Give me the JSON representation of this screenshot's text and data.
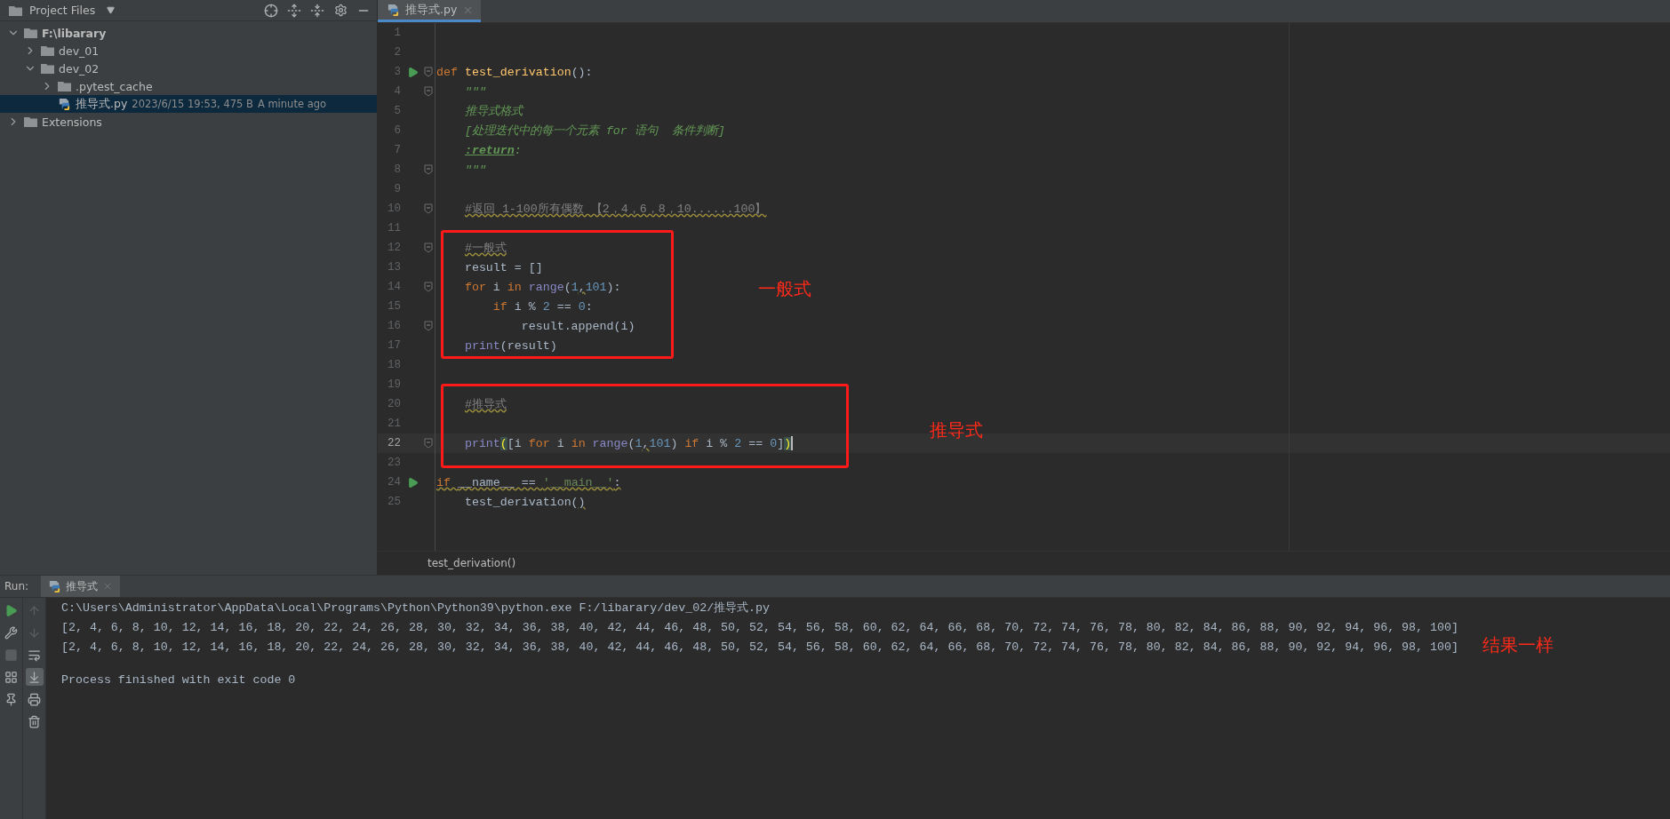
{
  "project_panel": {
    "title": "Project Files",
    "tree": [
      {
        "label": "F:\\libarary",
        "kind": "root",
        "expanded": true,
        "selected": false,
        "children": [
          {
            "label": "dev_01",
            "kind": "folder",
            "expanded": false,
            "selected": false
          },
          {
            "label": "dev_02",
            "kind": "folder",
            "expanded": true,
            "selected": false,
            "children": [
              {
                "label": ".pytest_cache",
                "kind": "folder",
                "expanded": false,
                "selected": false
              },
              {
                "label": "推导式.py",
                "kind": "file",
                "selected": true,
                "meta": "2023/6/15 19:53, 475 B",
                "modified": "A minute ago"
              }
            ]
          }
        ]
      },
      {
        "label": "Extensions",
        "kind": "folder",
        "expanded": false,
        "selected": false
      }
    ]
  },
  "editor": {
    "tab": {
      "label": "推导式.py",
      "selected": true
    },
    "lines": [
      {
        "number": "1",
        "run": false,
        "fold": false,
        "current": false
      },
      {
        "number": "2",
        "run": false,
        "fold": false,
        "current": false
      },
      {
        "number": "3",
        "run": true,
        "fold": true,
        "current": false,
        "tokens": [
          {
            "text": "def ",
            "kind": "kw"
          },
          {
            "text": "test_derivation",
            "kind": "fn"
          },
          {
            "text": "():",
            "kind": "txt"
          }
        ]
      },
      {
        "number": "4",
        "run": false,
        "fold": true,
        "current": false,
        "tokens": [
          {
            "text": "    \"\"\"",
            "kind": "doc"
          }
        ]
      },
      {
        "number": "5",
        "run": false,
        "fold": false,
        "current": false,
        "tokens": [
          {
            "text": "    推导式格式",
            "kind": "doc"
          }
        ]
      },
      {
        "number": "6",
        "run": false,
        "fold": false,
        "current": false,
        "tokens": [
          {
            "text": "    [处理迭代中的每一个元素 for 语句  条件判断]",
            "kind": "doc"
          }
        ]
      },
      {
        "number": "7",
        "run": false,
        "fold": false,
        "current": false,
        "tokens": [
          {
            "text": "    :return",
            "kind": "doctag"
          },
          {
            "text": ":",
            "kind": "doc"
          }
        ]
      },
      {
        "number": "8",
        "run": false,
        "fold": true,
        "current": false,
        "tokens": [
          {
            "text": "    \"\"\"",
            "kind": "doc"
          }
        ]
      },
      {
        "number": "9",
        "run": false,
        "fold": false,
        "current": false
      },
      {
        "number": "10",
        "run": false,
        "fold": true,
        "current": false,
        "tokens": [
          {
            "text": "    #返回 1-100所有偶数 【2，4，6，8，10......100】",
            "kind": "cmt",
            "warn": true
          }
        ]
      },
      {
        "number": "11",
        "run": false,
        "fold": false,
        "current": false
      },
      {
        "number": "12",
        "run": false,
        "fold": true,
        "current": false,
        "tokens": [
          {
            "text": "    #一般式",
            "kind": "cmt",
            "warn": true
          }
        ]
      },
      {
        "number": "13",
        "run": false,
        "fold": false,
        "current": false,
        "tokens": [
          {
            "text": "    result = []",
            "kind": "txt"
          }
        ]
      },
      {
        "number": "14",
        "run": false,
        "fold": true,
        "current": false,
        "tokens": [
          {
            "text": "    for ",
            "kind": "kw"
          },
          {
            "text": "i ",
            "kind": "txt"
          },
          {
            "text": "in ",
            "kind": "kw"
          },
          {
            "text": "range",
            "kind": "bi"
          },
          {
            "text": "(",
            "kind": "txt"
          },
          {
            "text": "1",
            "kind": "num"
          },
          {
            "text": ",",
            "kind": "txt",
            "warn": true
          },
          {
            "text": "101",
            "kind": "num"
          },
          {
            "text": "):",
            "kind": "txt"
          }
        ]
      },
      {
        "number": "15",
        "run": false,
        "fold": false,
        "current": false,
        "tokens": [
          {
            "text": "        if ",
            "kind": "kw"
          },
          {
            "text": "i % ",
            "kind": "txt"
          },
          {
            "text": "2",
            "kind": "num"
          },
          {
            "text": " == ",
            "kind": "txt"
          },
          {
            "text": "0",
            "kind": "num"
          },
          {
            "text": ":",
            "kind": "txt"
          }
        ]
      },
      {
        "number": "16",
        "run": false,
        "fold": true,
        "current": false,
        "tokens": [
          {
            "text": "            result.append(i)",
            "kind": "txt"
          }
        ]
      },
      {
        "number": "17",
        "run": false,
        "fold": false,
        "current": false,
        "tokens": [
          {
            "text": "    print",
            "kind": "bi"
          },
          {
            "text": "(result)",
            "kind": "txt"
          }
        ]
      },
      {
        "number": "18",
        "run": false,
        "fold": false,
        "current": false
      },
      {
        "number": "19",
        "run": false,
        "fold": false,
        "current": false
      },
      {
        "number": "20",
        "run": false,
        "fold": false,
        "current": false,
        "tokens": [
          {
            "text": "    #推导式",
            "kind": "cmt",
            "warn": true
          }
        ]
      },
      {
        "number": "21",
        "run": false,
        "fold": false,
        "current": false
      },
      {
        "number": "22",
        "run": false,
        "fold": true,
        "current": true,
        "tokens": [
          {
            "text": "    print",
            "kind": "bi"
          },
          {
            "text": "(",
            "kind": "match"
          },
          {
            "text": "[i ",
            "kind": "txt"
          },
          {
            "text": "for ",
            "kind": "kw"
          },
          {
            "text": "i ",
            "kind": "txt"
          },
          {
            "text": "in ",
            "kind": "kw"
          },
          {
            "text": "range",
            "kind": "bi"
          },
          {
            "text": "(",
            "kind": "txt"
          },
          {
            "text": "1",
            "kind": "num"
          },
          {
            "text": ",",
            "kind": "txt",
            "warn": true
          },
          {
            "text": "101",
            "kind": "num"
          },
          {
            "text": ") ",
            "kind": "txt"
          },
          {
            "text": "if ",
            "kind": "kw"
          },
          {
            "text": "i % ",
            "kind": "txt"
          },
          {
            "text": "2",
            "kind": "num"
          },
          {
            "text": " == ",
            "kind": "txt"
          },
          {
            "text": "0",
            "kind": "num"
          },
          {
            "text": "]",
            "kind": "txt"
          },
          {
            "text": ")",
            "kind": "match"
          }
        ]
      },
      {
        "number": "23",
        "run": false,
        "fold": false,
        "current": false
      },
      {
        "number": "24",
        "run": true,
        "fold": false,
        "current": false,
        "tokens": [
          {
            "text": "if ",
            "kind": "kw",
            "warn": true
          },
          {
            "text": "__name__ == ",
            "kind": "txt",
            "warn": true
          },
          {
            "text": "'__main__'",
            "kind": "str",
            "warn": true
          },
          {
            "text": ":",
            "kind": "txt",
            "warn": true
          }
        ]
      },
      {
        "number": "25",
        "run": false,
        "fold": false,
        "current": false,
        "tokens": [
          {
            "text": "    test_derivation(",
            "kind": "txt"
          },
          {
            "text": ")",
            "kind": "txt",
            "warn": true
          }
        ]
      }
    ],
    "breadcrumb": "test_derivation()",
    "annotations": [
      {
        "label": "一般式"
      },
      {
        "label": "推导式"
      }
    ]
  },
  "run_panel": {
    "label": "Run:",
    "tab": {
      "label": "推导式",
      "selected": true
    },
    "tools_left": [
      {
        "kind": "run",
        "disabled": false
      },
      {
        "kind": "wrench",
        "disabled": false
      },
      {
        "kind": "stop",
        "disabled": true
      },
      {
        "kind": "layout",
        "disabled": false
      },
      {
        "kind": "pin",
        "disabled": false
      }
    ],
    "tools_right": [
      {
        "kind": "up",
        "disabled": true,
        "on": false
      },
      {
        "kind": "down",
        "disabled": true,
        "on": false
      },
      {
        "kind": "wrap",
        "disabled": false,
        "on": false
      },
      {
        "kind": "scroll_end",
        "disabled": false,
        "on": true
      },
      {
        "kind": "print",
        "disabled": false,
        "on": false
      },
      {
        "kind": "trash",
        "disabled": false,
        "on": false
      }
    ],
    "output": [
      "C:\\Users\\Administrator\\AppData\\Local\\Programs\\Python\\Python39\\python.exe F:/libarary/dev_02/推导式.py",
      "[2, 4, 6, 8, 10, 12, 14, 16, 18, 20, 22, 24, 26, 28, 30, 32, 34, 36, 38, 40, 42, 44, 46, 48, 50, 52, 54, 56, 58, 60, 62, 64, 66, 68, 70, 72, 74, 76, 78, 80, 82, 84, 86, 88, 90, 92, 94, 96, 98, 100]",
      "[2, 4, 6, 8, 10, 12, 14, 16, 18, 20, 22, 24, 26, 28, 30, 32, 34, 36, 38, 40, 42, 44, 46, 48, 50, 52, 54, 56, 58, 60, 62, 64, 66, 68, 70, 72, 74, 76, 78, 80, 82, 84, 86, 88, 90, 92, 94, 96, 98, 100]"
    ],
    "exit_message": "Process finished with exit code 0",
    "annotation": "结果一样"
  }
}
